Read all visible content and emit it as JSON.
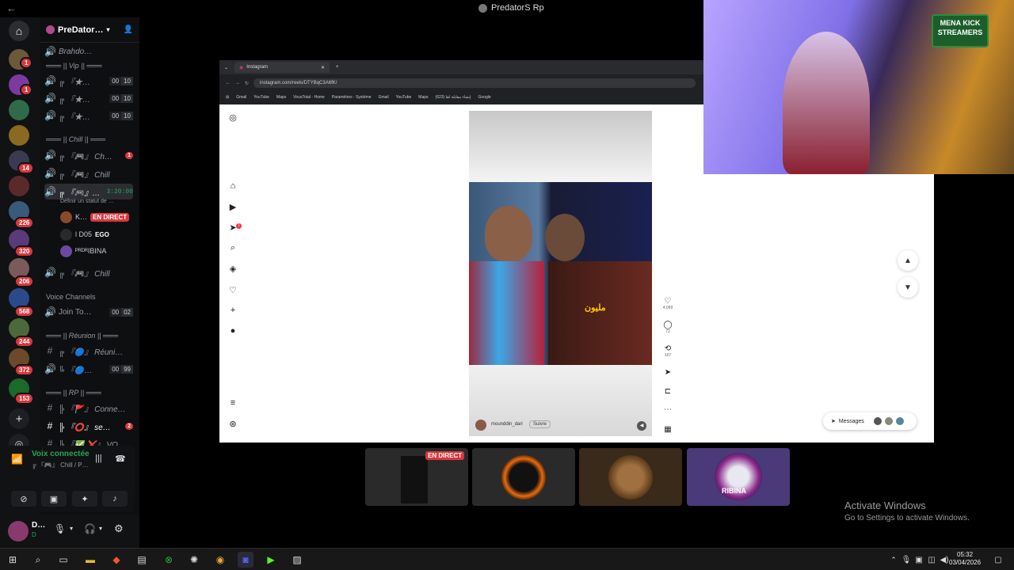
{
  "window": {
    "title": "PredatorS Rp",
    "back": "←"
  },
  "server": {
    "name": "PreDator…",
    "add_icon": "add-user-icon"
  },
  "rail": {
    "badges": [
      "1",
      "1",
      "14",
      "226",
      "320",
      "206",
      "568",
      "244",
      "372",
      "153"
    ]
  },
  "channels": {
    "top_item": "Brahdo…",
    "vip_category": "═══ || Vip || ═══",
    "vip_channels": [
      {
        "name": "╔ 『★…",
        "counts": [
          "00",
          "10"
        ]
      },
      {
        "name": "╔ 『★…",
        "counts": [
          "00",
          "10"
        ]
      },
      {
        "name": "╔ 『★…",
        "counts": [
          "00",
          "10"
        ]
      }
    ],
    "chill_category": "═══ || Chill || ═══",
    "chill1": {
      "name": "╔ 『🎮』 Ch…",
      "badge": "1"
    },
    "chill2": {
      "name": "╔ 『🎮』 Chill"
    },
    "active": {
      "name": "╔ 『🎮』…",
      "timer": "3:20:00",
      "status": "Définir un statut de …"
    },
    "members": [
      {
        "name": "K…",
        "live": "EN DIRECT"
      },
      {
        "name": "l D05",
        "tag": "EGO"
      },
      {
        "name": "ᴾᴿᴰᴿIBINA"
      }
    ],
    "chill3": {
      "name": "╔ 『🎮』 Chill"
    },
    "voice_category": "Voice Channels",
    "join": {
      "name": "Join To…",
      "counts": [
        "00",
        "02"
      ]
    },
    "reunion_category": "═══ || Réunion || ═══",
    "reunion1": {
      "name": "╔ 『🔵』 Réuni…"
    },
    "reunion2": {
      "name": "╚ 『🔵…",
      "counts": [
        "00",
        "99"
      ]
    },
    "rp_category": "═══ || RP || ═══",
    "rp1": {
      "name": "╠ 『🚩』 Conne…"
    },
    "rp2": {
      "name": "╠ 『⭕』 se…",
      "badge": "2"
    },
    "rp3": {
      "name": "╠ 『✅ ❌』 VO…"
    }
  },
  "voice": {
    "status": "Voix connectée",
    "channel": "╔ 『🎮』 Chill / P…"
  },
  "user": {
    "name": "D…",
    "sub": "D"
  },
  "browser": {
    "tab_title": "Instagram",
    "url": "instagram.com/reels/DTYBqC3A6fK/",
    "bookmarks": [
      "Gmail",
      "YouTube",
      "Maps",
      "VirusTotal - Home",
      "Paramètres - Système",
      "Gmail",
      "YouTube",
      "Maps",
      "إنشاء مقابلة لقا (623)",
      "Google"
    ]
  },
  "instagram": {
    "caption_overlay": "مليون",
    "likes": "4,099",
    "comments": "72",
    "shares": "167",
    "author": "mounddin_dari",
    "follow": "Suivre",
    "messages": "Messages",
    "notification": "1"
  },
  "stream": {
    "logo": "MENA KICK STREAMERS",
    "tile_live": "EN DIRECT",
    "tile4_text": "RIBINA"
  },
  "watermark": {
    "line1": "Activate Windows",
    "line2": "Go to Settings to activate Windows."
  },
  "taskbar": {
    "time": "05:32",
    "date": "03/04/2026"
  },
  "colors": {
    "discord_red": "#da373c",
    "voice_green": "#23a55a",
    "ig_bg": "#ffffff"
  }
}
